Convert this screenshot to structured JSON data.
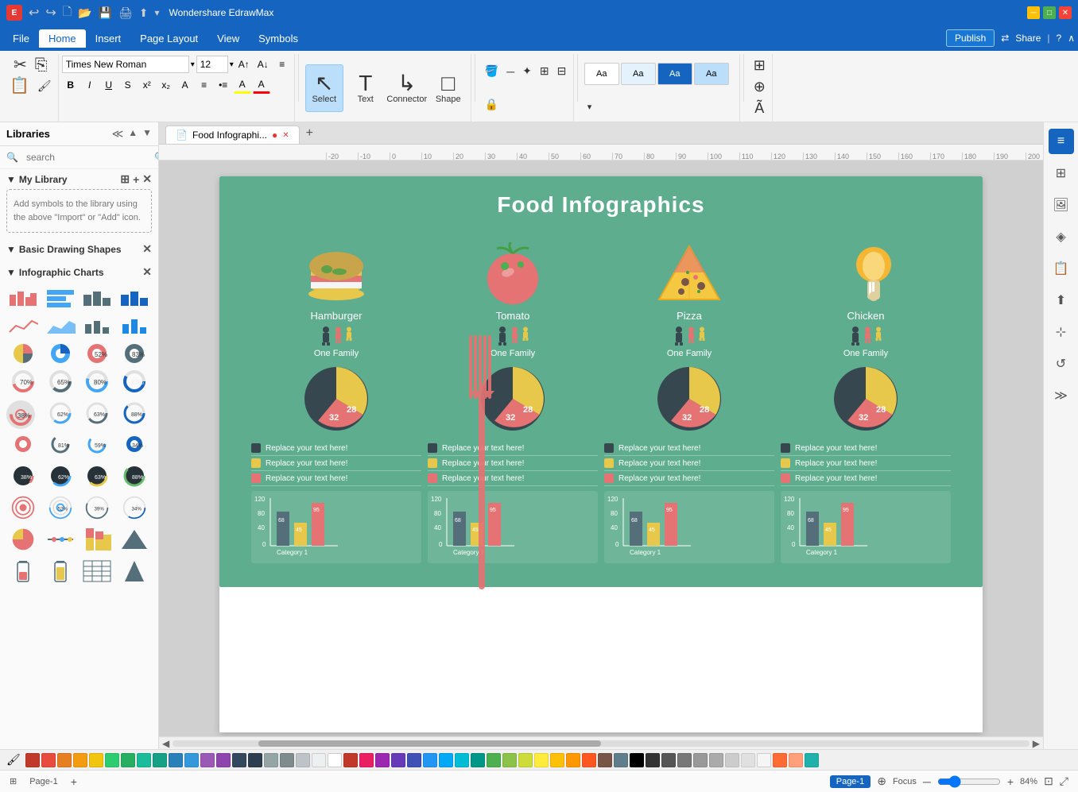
{
  "app": {
    "title": "Wondershare EdrawMax",
    "icon": "E"
  },
  "titlebar": {
    "undo_icon": "↩",
    "redo_icon": "↪",
    "new_icon": "🗋",
    "open_icon": "📂",
    "save_icon": "💾",
    "print_icon": "🖨",
    "export_icon": "⬆",
    "more_icon": "▾",
    "min_label": "─",
    "max_label": "□",
    "close_label": "✕"
  },
  "menubar": {
    "items": [
      "File",
      "Home",
      "Insert",
      "Page Layout",
      "View",
      "Symbols"
    ],
    "active_item": "Home",
    "publish_label": "Publish",
    "share_label": "Share",
    "help_icon": "?",
    "collapse_icon": "∧"
  },
  "ribbon": {
    "font_name": "Times New Roman",
    "font_size": "12",
    "bold_label": "B",
    "italic_label": "I",
    "underline_label": "U",
    "strikethrough_label": "S",
    "superscript_label": "x²",
    "subscript_label": "x₂",
    "text_direction_label": "A",
    "list_label": "≡",
    "bullets_label": "•≡",
    "highlight_label": "A",
    "font_color_label": "A",
    "increase_font_label": "A↑",
    "decrease_font_label": "A↓",
    "align_label": "≡",
    "select_label": "Select",
    "text_label": "Text",
    "connector_label": "Connector",
    "shape_label": "Shape",
    "style_previews": [
      "Aa",
      "Aa",
      "Aa",
      "Aa"
    ]
  },
  "sidebar": {
    "title": "Libraries",
    "search_placeholder": "search",
    "my_library_title": "My Library",
    "my_library_hint": "Add symbols to the library using the above \"Import\" or \"Add\" icon.",
    "basic_shapes_title": "Basic Drawing Shapes",
    "infographic_title": "Infographic Charts"
  },
  "tabs": {
    "active": "Food Infographi...",
    "dot_color": "#e53935"
  },
  "canvas": {
    "title": "Food Infographics",
    "foods": [
      {
        "name": "Hamburger",
        "color": "#e57373",
        "fork_color": "#e57373"
      },
      {
        "name": "Tomato",
        "color": "#546e7a",
        "fork_color": "#546e7a"
      },
      {
        "name": "Pizza",
        "color": "#e0d5b5",
        "fork_color": "#e0d5b5"
      },
      {
        "name": "Chicken",
        "color": "#43a047",
        "fork_color": "#43a047"
      }
    ],
    "family_label": "One Family",
    "pie_values": {
      "v1": 40,
      "v2": 28,
      "v3": 32
    },
    "pie_colors": {
      "c1": "#e8c84a",
      "c2": "#e57373",
      "c3": "#37474f"
    },
    "legend_items": [
      {
        "color": "#37474f",
        "text": "Replace your text here!"
      },
      {
        "color": "#e8c84a",
        "text": "Replace your text here!"
      },
      {
        "color": "#e57373",
        "text": "Replace your text here!"
      }
    ],
    "bar_values": [
      68,
      45,
      95
    ],
    "bar_colors": [
      "#546e7a",
      "#e8c84a",
      "#e57373"
    ],
    "bar_max": 120,
    "bar_labels": [
      "Category 1"
    ],
    "bar_y_labels": [
      "120",
      "80",
      "40",
      "0"
    ]
  },
  "statusbar": {
    "page_label": "Page-1",
    "active_tab_label": "Page-1",
    "focus_label": "Focus",
    "zoom_level": "84%",
    "page_icon": "⊞",
    "add_page_icon": "+"
  },
  "colors": [
    "#c0392b",
    "#e74c3c",
    "#e67e22",
    "#f39c12",
    "#f1c40f",
    "#2ecc71",
    "#27ae60",
    "#1abc9c",
    "#16a085",
    "#2980b9",
    "#3498db",
    "#9b59b6",
    "#8e44ad",
    "#34495e",
    "#2c3e50",
    "#95a5a6",
    "#7f8c8d",
    "#bdc3c7",
    "#ecf0f1",
    "#ffffff",
    "#c0392b",
    "#e74c3c",
    "#e91e63",
    "#9c27b0",
    "#673ab7",
    "#3f51b5",
    "#2196f3",
    "#03a9f4",
    "#00bcd4",
    "#009688",
    "#4caf50",
    "#8bc34a",
    "#cddc39",
    "#ffeb3b",
    "#ffc107",
    "#ff9800",
    "#ff5722",
    "#795548",
    "#607d8b",
    "#000000"
  ],
  "right_panel": {
    "buttons": [
      "⊞",
      "🖼",
      "≡",
      "⊡",
      "✂",
      "↺"
    ]
  }
}
